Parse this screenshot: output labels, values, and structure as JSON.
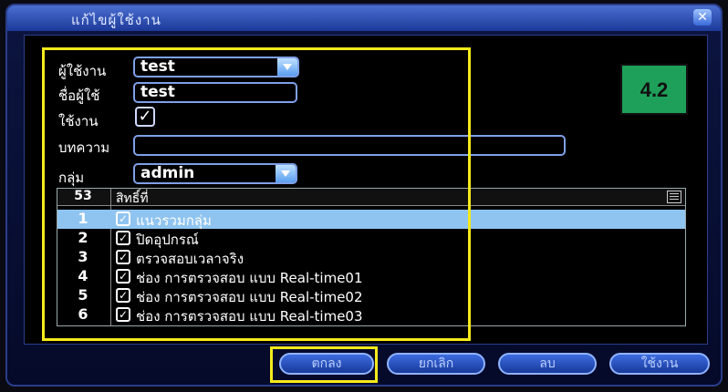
{
  "window": {
    "title": "แก้ไขผู้ใช้งาน"
  },
  "form": {
    "user_label": "ผู้ใช้งาน",
    "user_value": "test",
    "name_label": "ชื่อผู้ใช้",
    "name_value": "test",
    "enable_label": "ใช้งาน",
    "enable_checked": true,
    "note_label": "บทความ",
    "note_value": "",
    "group_label": "กลุ่ม",
    "group_value": "admin"
  },
  "list": {
    "count": "53",
    "header": "สิทธิ์ที่",
    "rows": [
      {
        "num": "1",
        "text": "แนวรวมกลุ่ม",
        "checked": true,
        "selected": true
      },
      {
        "num": "2",
        "text": "ปิดอุปกรณ์",
        "checked": true
      },
      {
        "num": "3",
        "text": "ตรวจสอบเวลาจริง",
        "checked": true
      },
      {
        "num": "4",
        "text": "ช่อง การตรวจสอบ แบบ Real-time01",
        "checked": true
      },
      {
        "num": "5",
        "text": "ช่อง การตรวจสอบ แบบ Real-time02",
        "checked": true
      },
      {
        "num": "6",
        "text": "ช่อง การตรวจสอบ แบบ Real-time03",
        "checked": true
      }
    ]
  },
  "buttons": {
    "ok": "ตกลง",
    "cancel": "ยกเลิก",
    "delete": "ลบ",
    "apply": "ใช้งาน"
  },
  "annotation": {
    "badge": "4.2"
  },
  "colors": {
    "highlight": "#f4ea1a",
    "badge": "#1fa05a",
    "selected_row": "#8fc4f0"
  }
}
